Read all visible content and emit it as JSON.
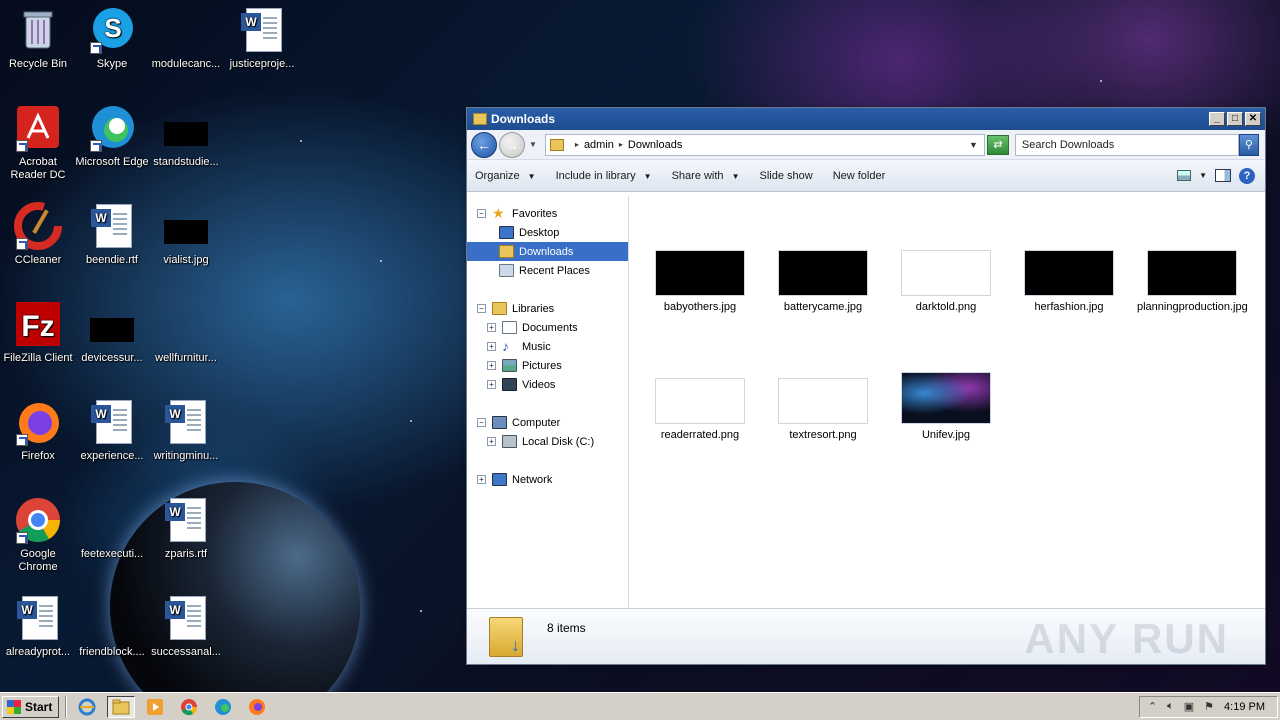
{
  "desktop": {
    "icons": [
      {
        "label": "Recycle Bin",
        "icon": "recycle-bin-icon"
      },
      {
        "label": "Skype",
        "icon": "skype-icon"
      },
      {
        "label": "modulecanc...",
        "icon": "file-icon"
      },
      {
        "label": "justiceproje...",
        "icon": "word-document-icon"
      },
      {
        "label": "Acrobat Reader DC",
        "icon": "acrobat-icon"
      },
      {
        "label": "Microsoft Edge",
        "icon": "edge-icon"
      },
      {
        "label": "standstudie...",
        "icon": "image-file-icon"
      },
      {
        "label": "CCleaner",
        "icon": "ccleaner-icon"
      },
      {
        "label": "beendie.rtf",
        "icon": "word-document-icon"
      },
      {
        "label": "vialist.jpg",
        "icon": "image-file-icon"
      },
      {
        "label": "FileZilla Client",
        "icon": "filezilla-icon"
      },
      {
        "label": "devicessur...",
        "icon": "image-file-icon"
      },
      {
        "label": "wellfurnitur...",
        "icon": "file-icon"
      },
      {
        "label": "Firefox",
        "icon": "firefox-icon"
      },
      {
        "label": "experience...",
        "icon": "word-document-icon"
      },
      {
        "label": "writingminu...",
        "icon": "word-document-icon"
      },
      {
        "label": "Google Chrome",
        "icon": "chrome-icon"
      },
      {
        "label": "feetexecuti...",
        "icon": "file-icon"
      },
      {
        "label": "zparis.rtf",
        "icon": "word-document-icon"
      },
      {
        "label": "alreadyprot...",
        "icon": "word-document-icon"
      },
      {
        "label": "friendblock....",
        "icon": "file-icon"
      },
      {
        "label": "successanal...",
        "icon": "word-document-icon"
      }
    ]
  },
  "window": {
    "title": "Downloads",
    "buttons": {
      "minimize": "_",
      "maximize": "□",
      "close": "✕"
    },
    "address": {
      "crumbs": [
        "admin",
        "Downloads"
      ]
    },
    "search": {
      "placeholder": "Search Downloads"
    },
    "toolbar": {
      "organize": "Organize",
      "include_in_library": "Include in library",
      "share_with": "Share with",
      "slide_show": "Slide show",
      "new_folder": "New folder"
    },
    "nav": {
      "favorites": "Favorites",
      "desktop": "Desktop",
      "downloads": "Downloads",
      "recent_places": "Recent Places",
      "libraries": "Libraries",
      "documents": "Documents",
      "music": "Music",
      "pictures": "Pictures",
      "videos": "Videos",
      "computer": "Computer",
      "local_disk": "Local Disk (C:)",
      "network": "Network"
    },
    "files": [
      {
        "name": "babyothers.jpg",
        "thumb": "#000000"
      },
      {
        "name": "batterycame.jpg",
        "thumb": "#000000"
      },
      {
        "name": "darktold.png",
        "thumb": "#ffffff"
      },
      {
        "name": "herfashion.jpg",
        "thumb": "#000000"
      },
      {
        "name": "planningproduction.jpg",
        "thumb": "#000000"
      },
      {
        "name": "readerrated.png",
        "thumb": "#ffffff"
      },
      {
        "name": "textresort.png",
        "thumb": "#ffffff"
      },
      {
        "name": "Unifev.jpg",
        "thumb": "space"
      }
    ],
    "status": {
      "count": "8 items"
    },
    "watermark": "ANY RUN"
  },
  "taskbar": {
    "start_label": "Start",
    "clock": "4:19 PM",
    "tasks": [
      "internet-explorer-icon",
      "explorer-icon",
      "media-player-icon",
      "chrome-icon",
      "edge-icon",
      "firefox-icon"
    ]
  }
}
